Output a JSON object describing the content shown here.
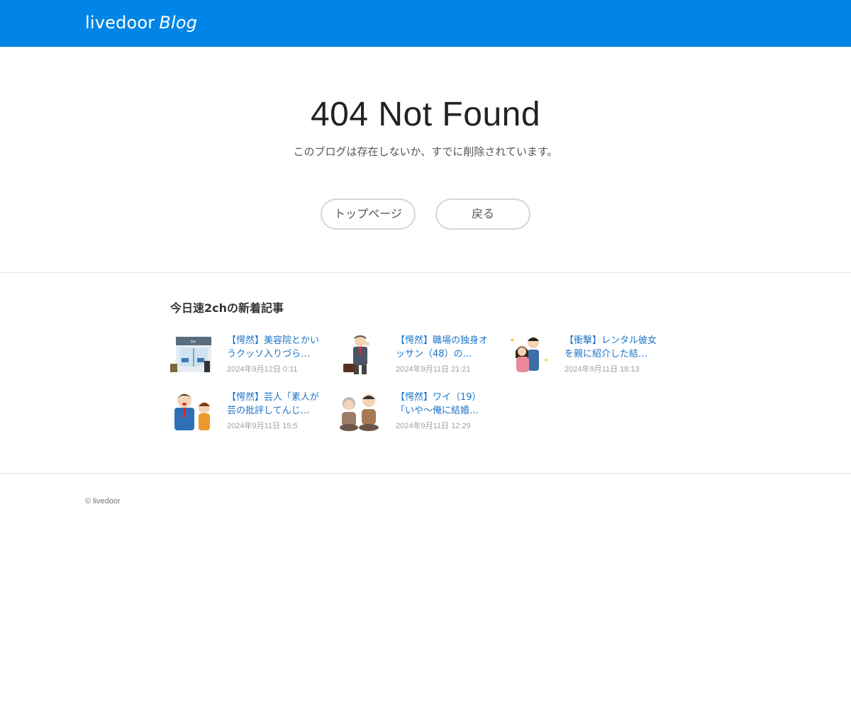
{
  "header": {
    "logo_brand": "livedoor",
    "logo_product": "Blog",
    "background_color": "#0085e6"
  },
  "error": {
    "title": "404 Not Found",
    "message": "このブログは存在しないか、すでに削除されています。"
  },
  "buttons": {
    "top_page": "トップページ",
    "back": "戻る"
  },
  "recent": {
    "title": "今日速2chの新着記事",
    "articles": [
      {
        "title": "【愕然】美容院とかいうクッソ入りづら…",
        "date": "2024年9月12日 0:11",
        "thumbnail": "salon-illustration"
      },
      {
        "title": "【愕然】職場の独身オッサン（48）の…",
        "date": "2024年9月11日 21:21",
        "thumbnail": "office-man-illustration"
      },
      {
        "title": "【衝撃】レンタル彼女を親に紹介した結…",
        "date": "2024年9月11日 18:13",
        "thumbnail": "couple-illustration"
      },
      {
        "title": "【愕然】芸人「素人が芸の批評してんじ…",
        "date": "2024年9月11日 15:5",
        "thumbnail": "comedian-illustration"
      },
      {
        "title": "【愕然】ワイ（19）「いや〜俺に結婚…",
        "date": "2024年9月11日 12:29",
        "thumbnail": "elderly-couple-illustration"
      }
    ]
  },
  "footer": {
    "copyright": "© livedoor"
  }
}
